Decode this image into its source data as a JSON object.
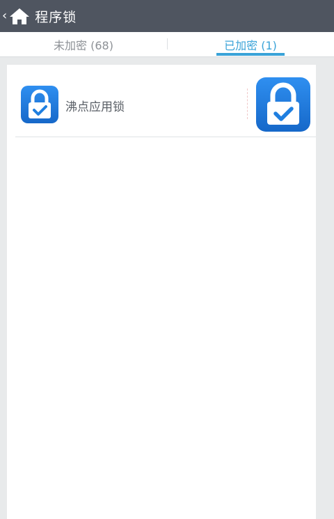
{
  "header": {
    "back_glyph": "‹",
    "home_icon": "home-icon",
    "title": "程序锁"
  },
  "tabs": [
    {
      "label": "未加密 (68)",
      "active": false
    },
    {
      "label": "已加密 (1)",
      "active": true
    }
  ],
  "apps": [
    {
      "name": "沸点应用锁",
      "icon": "padlock-check-icon",
      "lock_state": "locked"
    }
  ],
  "colors": {
    "titlebar": "#4f5560",
    "accent": "#3aa3d8",
    "icon_blue": "#1f7fe0"
  }
}
